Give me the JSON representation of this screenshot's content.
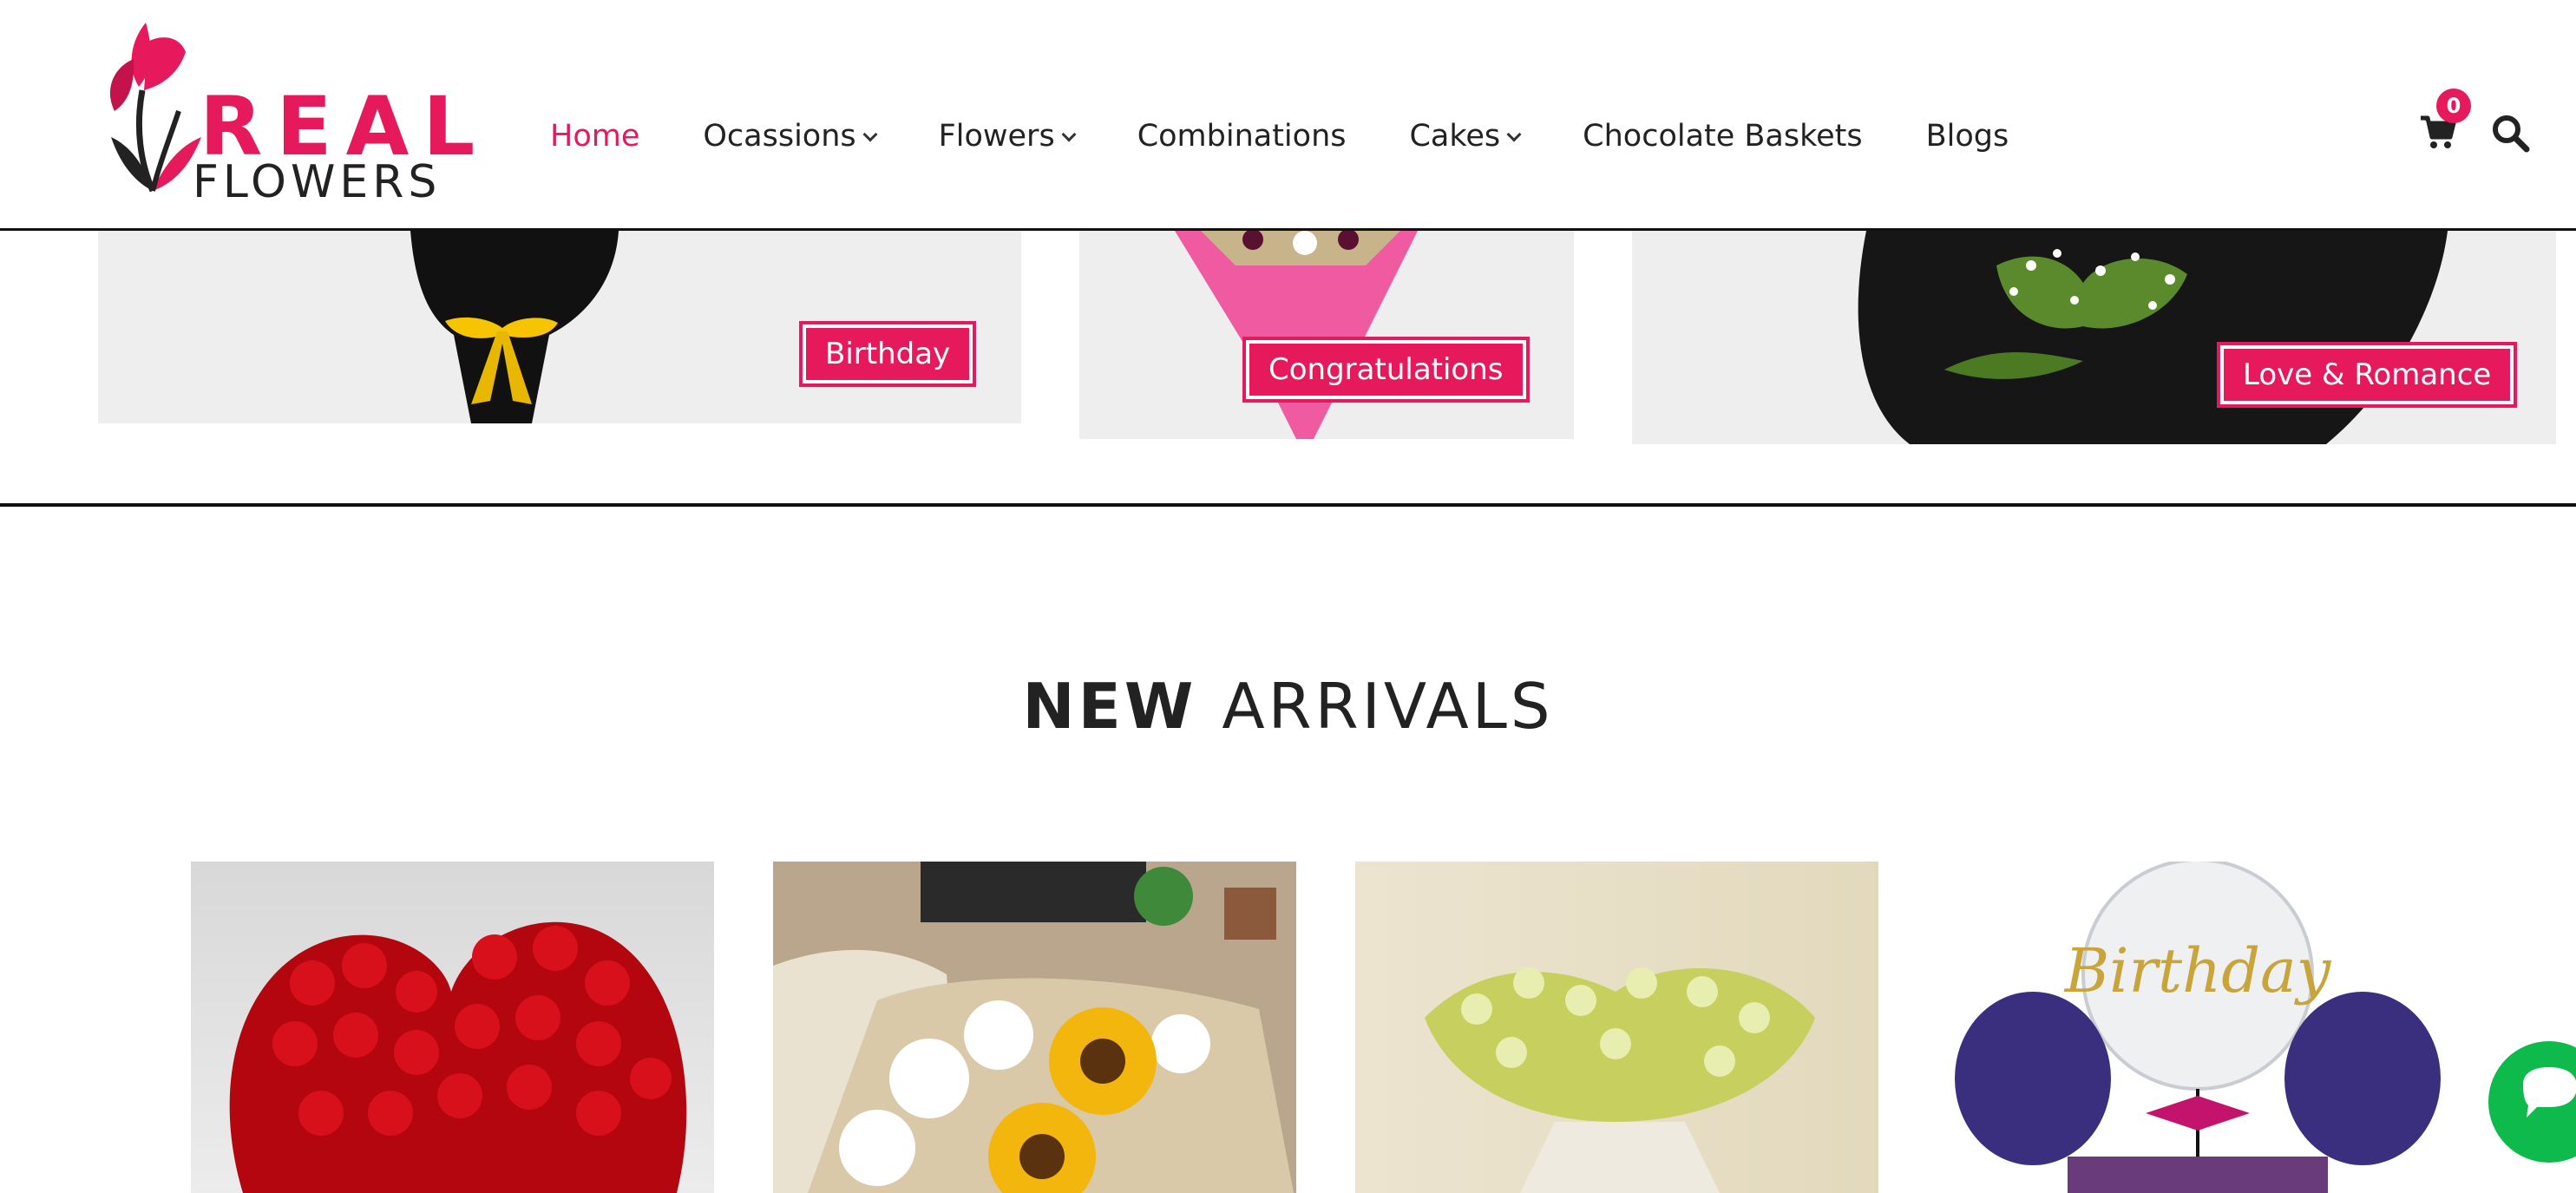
{
  "brand": {
    "name_line1": "REAL",
    "name_line2": "FLOWERS",
    "accent_color": "#e6195c"
  },
  "nav": {
    "items": [
      {
        "label": "Home",
        "active": true,
        "has_dropdown": false
      },
      {
        "label": "Ocassions",
        "active": false,
        "has_dropdown": true
      },
      {
        "label": "Flowers",
        "active": false,
        "has_dropdown": true
      },
      {
        "label": "Combinations",
        "active": false,
        "has_dropdown": false
      },
      {
        "label": "Cakes",
        "active": false,
        "has_dropdown": true
      },
      {
        "label": "Chocolate Baskets",
        "active": false,
        "has_dropdown": false
      },
      {
        "label": "Blogs",
        "active": false,
        "has_dropdown": false
      }
    ]
  },
  "cart": {
    "count": "0",
    "icon": "cart-icon"
  },
  "search": {
    "icon": "search-icon"
  },
  "occasions": {
    "tags": [
      "Birthday",
      "Congratulations",
      "Love & Romance"
    ]
  },
  "new_arrivals": {
    "title_bold": "NEW",
    "title_light": "ARRIVALS",
    "product_overlay_text": "Birthday"
  },
  "chat": {
    "icon": "chat-icon",
    "color": "#0dba4b"
  }
}
